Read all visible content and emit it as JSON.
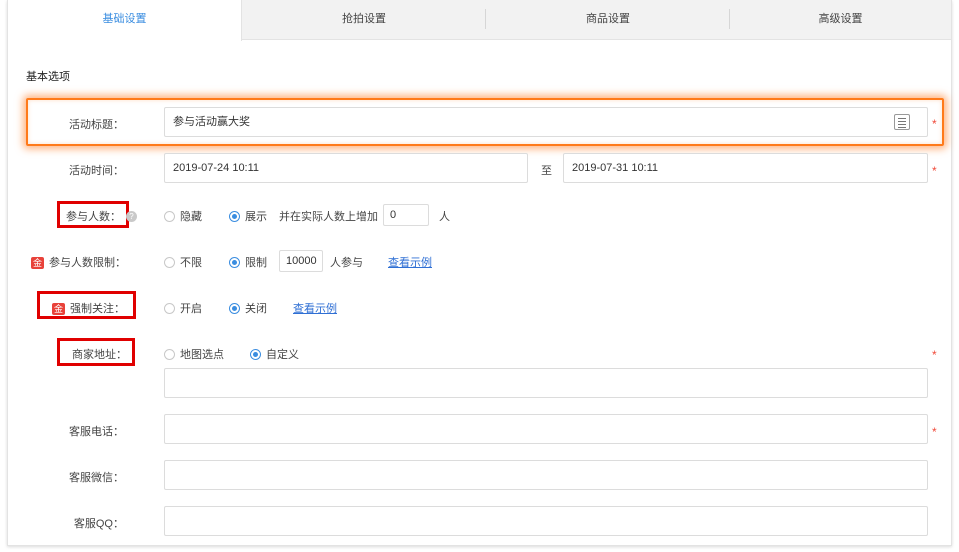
{
  "tabs": [
    {
      "label": "基础设置",
      "active": true
    },
    {
      "label": "抢拍设置",
      "active": false
    },
    {
      "label": "商品设置",
      "active": false
    },
    {
      "label": "高级设置",
      "active": false
    }
  ],
  "section_title": "基本选项",
  "fields": {
    "title": {
      "label": "活动标题：",
      "value": "参与活动赢大奖"
    },
    "time": {
      "label": "活动时间：",
      "start": "2019-07-24 10:11",
      "separator": "至",
      "end": "2019-07-31 10:11"
    },
    "participants": {
      "label": "参与人数：",
      "help": "?",
      "hide": "隐藏",
      "show": "展示",
      "add_text": "并在实际人数上增加",
      "add_value": "0",
      "unit": "人"
    },
    "limit": {
      "label": "参与人数限制：",
      "badge": "金",
      "unlimited": "不限",
      "limited": "限制",
      "limit_value": "10000",
      "suffix": "人参与",
      "example_link": "查看示例"
    },
    "follow": {
      "label": "强制关注：",
      "badge": "金",
      "on": "开启",
      "off": "关闭",
      "example_link": "查看示例"
    },
    "address": {
      "label": "商家地址：",
      "map": "地图选点",
      "custom": "自定义",
      "value": ""
    },
    "phone": {
      "label": "客服电话：",
      "value": ""
    },
    "wechat": {
      "label": "客服微信：",
      "value": ""
    },
    "qq": {
      "label": "客服QQ：",
      "value": ""
    }
  },
  "required_mark": "*",
  "colors": {
    "accent": "#3a8de0",
    "link": "#2f6fd4",
    "required": "#f04a3a",
    "highlight_orange": "#ff7a1a",
    "highlight_red": "#e00000"
  }
}
